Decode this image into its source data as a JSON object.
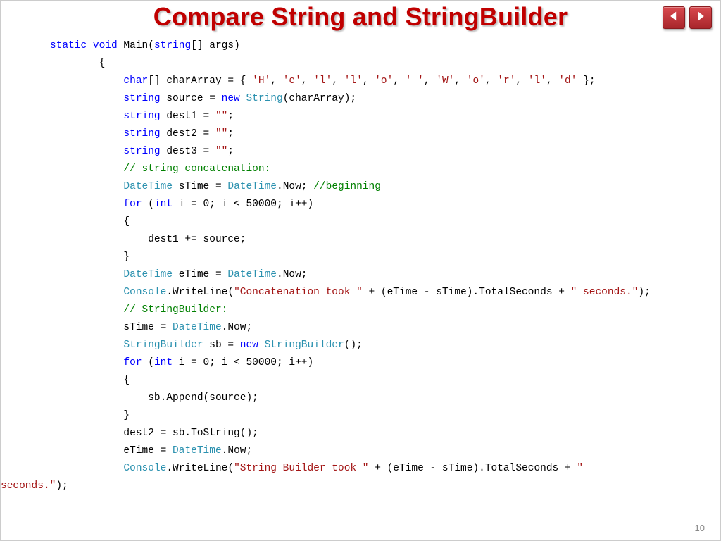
{
  "title": "Compare String and StringBuilder",
  "pageNumber": "10",
  "nav": {
    "prev": "Previous slide",
    "next": "Next slide"
  },
  "code": {
    "kw_static": "static",
    "kw_void": "void",
    "sig_main": " Main(",
    "kw_string_arr": "string",
    "sig_args": "[] args)",
    "open_brace": "        {",
    "l3a": "char",
    "l3b": "[] charArray = { ",
    "l3c": "'H'",
    "l3d": ", ",
    "l3e": "'e'",
    "l3f": "'l'",
    "l3g": "'l'",
    "l3h": "'o'",
    "l3i": "' '",
    "l3j": "'W'",
    "l3k": "'o'",
    "l3l": "'r'",
    "l3m": "'l'",
    "l3n": "'d'",
    "l3end": " };",
    "l4a": "string",
    "l4b": " source = ",
    "kw_new": "new",
    "l4c": " ",
    "typ_String": "String",
    "l4d": "(charArray);",
    "l5a": "string",
    "l5b": " dest1 = ",
    "empty": "\"\"",
    "semi": ";",
    "l6a": "string",
    "l6b": " dest2 = ",
    "l7a": "string",
    "l7b": " dest3 = ",
    "c1": "// string concatenation:",
    "typ_DateTime": "DateTime",
    "l9b": " sTime = ",
    "l9c": ".Now; ",
    "c2": "//beginning",
    "kw_for": "for",
    "l10b": " (",
    "kw_int": "int",
    "l10c": " i = 0; i < 50000; i++)",
    "ob": "{",
    "cb": "}",
    "l12": "    dest1 += source;",
    "l14b": " eTime = ",
    "l14c": ".Now;",
    "typ_Console": "Console",
    "l15a": ".WriteLine(",
    "s1": "\"Concatenation took \"",
    "l15b": " + (eTime - sTime).TotalSeconds + ",
    "s2": "\" seconds.\"",
    "l15c": ");",
    "c3": "// StringBuilder:",
    "l17": "sTime = ",
    "l17b": ".Now;",
    "typ_SB": "StringBuilder",
    "l18b": " sb = ",
    "l18c": "();",
    "l21": "    sb.Append(source);",
    "l23": "dest2 = sb.ToString();",
    "l24": "eTime = ",
    "l24b": ".Now;",
    "s3": "\"String Builder took \"",
    "l25b": " + (eTime - sTime).TotalSeconds + ",
    "s4": "\"\nseconds.\"",
    "s4a": "\" ",
    "s4b": "seconds.\"",
    "l25c": ");"
  }
}
